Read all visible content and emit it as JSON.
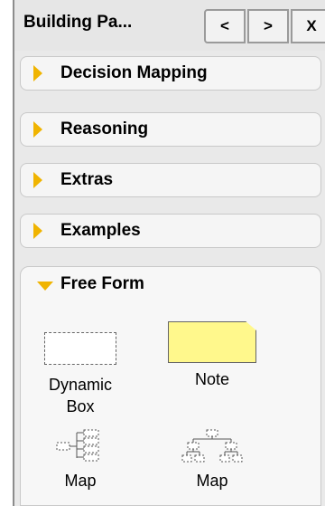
{
  "header": {
    "title": "Building Pa...",
    "prev_label": "<",
    "next_label": ">",
    "close_label": "X"
  },
  "sections": [
    {
      "label": "Decision Mapping"
    },
    {
      "label": "Reasoning"
    },
    {
      "label": "Extras"
    },
    {
      "label": "Examples"
    }
  ],
  "free_form": {
    "label": "Free Form",
    "items": [
      {
        "label_line1": "Dynamic",
        "label_line2": "Box",
        "icon": "dashed-box-icon"
      },
      {
        "label_line1": "Note",
        "icon": "note-icon"
      },
      {
        "label_line1": "Map",
        "icon": "left-map-icon"
      },
      {
        "label_line1": "Map",
        "icon": "tree-map-icon"
      }
    ]
  },
  "colors": {
    "accent_arrow": "#f0b400",
    "note_fill": "#fff88c",
    "panel_bg": "#e9e9e9"
  }
}
